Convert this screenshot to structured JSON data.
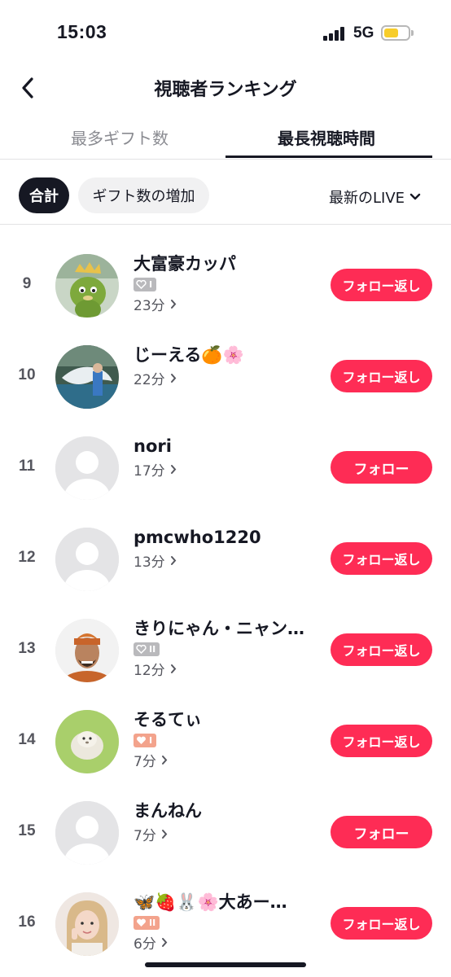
{
  "status_bar": {
    "time": "15:03",
    "network": "5G",
    "battery_color": "#f7cd2a"
  },
  "header": {
    "title": "視聴者ランキング",
    "back_icon": "chevron-left-icon"
  },
  "tabs": [
    {
      "label": "最多ギフト数",
      "active": false
    },
    {
      "label": "最長視聴時間",
      "active": true
    }
  ],
  "filters": {
    "chips": [
      {
        "label": "合計",
        "active": true
      },
      {
        "label": "ギフト数の増加",
        "active": false
      }
    ],
    "dropdown_label": "最新のLIVE"
  },
  "rows": [
    {
      "rank": "9",
      "name": "大富豪カッパ",
      "badge": "I",
      "badge_style": "gray",
      "duration": "23分",
      "button": "フォロー返し",
      "avatar": "kappa-character"
    },
    {
      "rank": "10",
      "name": "じーえる🍊🌸",
      "badge": "",
      "badge_style": "",
      "duration": "22分",
      "button": "フォロー返し",
      "avatar": "dolphin-photo"
    },
    {
      "rank": "11",
      "name": "nori",
      "badge": "",
      "badge_style": "",
      "duration": "17分",
      "button": "フォロー",
      "avatar": "default"
    },
    {
      "rank": "12",
      "name": "pmcwho1220",
      "badge": "",
      "badge_style": "",
      "duration": "13分",
      "button": "フォロー返し",
      "avatar": "default"
    },
    {
      "rank": "13",
      "name": "きりにゃん・ニャン…",
      "badge": "II",
      "badge_style": "gray",
      "duration": "12分",
      "button": "フォロー返し",
      "avatar": "man-orange-turban"
    },
    {
      "rank": "14",
      "name": "そるてぃ",
      "badge": "I",
      "badge_style": "orange",
      "duration": "7分",
      "button": "フォロー返し",
      "avatar": "white-furry-animal"
    },
    {
      "rank": "15",
      "name": "まんねん",
      "badge": "",
      "badge_style": "",
      "duration": "7分",
      "button": "フォロー",
      "avatar": "default"
    },
    {
      "rank": "16",
      "name": "🦋🍓🐰🌸大あー…",
      "badge": "II",
      "badge_style": "orange",
      "duration": "6分",
      "button": "フォロー返し",
      "avatar": "woman-peace-sign"
    }
  ],
  "colors": {
    "accent": "#fe2c55",
    "text_primary": "#161823",
    "text_secondary": "#55565e"
  }
}
